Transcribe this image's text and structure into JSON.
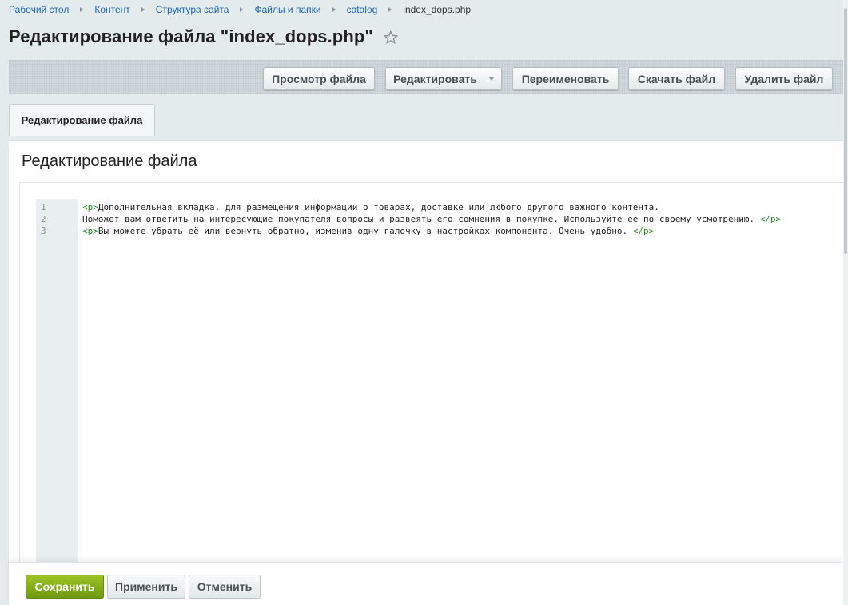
{
  "breadcrumbs": [
    {
      "label": "Рабочий стол"
    },
    {
      "label": "Контент"
    },
    {
      "label": "Структура сайта"
    },
    {
      "label": "Файлы и папки"
    },
    {
      "label": "catalog"
    },
    {
      "label": "index_dops.php"
    }
  ],
  "page": {
    "title": "Редактирование файла \"index_dops.php\"",
    "favorite_icon": "star-outline-icon"
  },
  "toolbar": {
    "view_label": "Просмотр файла",
    "edit_label": "Редактировать",
    "rename_label": "Переименовать",
    "download_label": "Скачать файл",
    "delete_label": "Удалить файл"
  },
  "tabs": [
    {
      "label": "Редактирование файла",
      "active": true
    }
  ],
  "panel": {
    "title": "Редактирование файла"
  },
  "editor": {
    "lines": [
      {
        "num": "1",
        "open_tag": "<p>",
        "text": "Дополнительная вкладка, для размещения информации о товарах, доставке или любого другого важного контента.",
        "close_tag": ""
      },
      {
        "num": "2",
        "open_tag": "",
        "text": "Поможет вам ответить на интересующие покупателя вопросы и развеять его сомнения в покупке. Используйте её по своему усмотрению. ",
        "close_tag": "</p>"
      },
      {
        "num": "3",
        "open_tag": "<p>",
        "text": "Вы можете убрать её или вернуть обратно, изменив одну галочку в настройках компонента. Очень удобно. ",
        "close_tag": "</p>"
      }
    ]
  },
  "actions": {
    "save_label": "Сохранить",
    "apply_label": "Применить",
    "cancel_label": "Отменить"
  },
  "colors": {
    "save_button": "#7da817",
    "link": "#2067b0",
    "code_tag": "#2a8a2a"
  }
}
